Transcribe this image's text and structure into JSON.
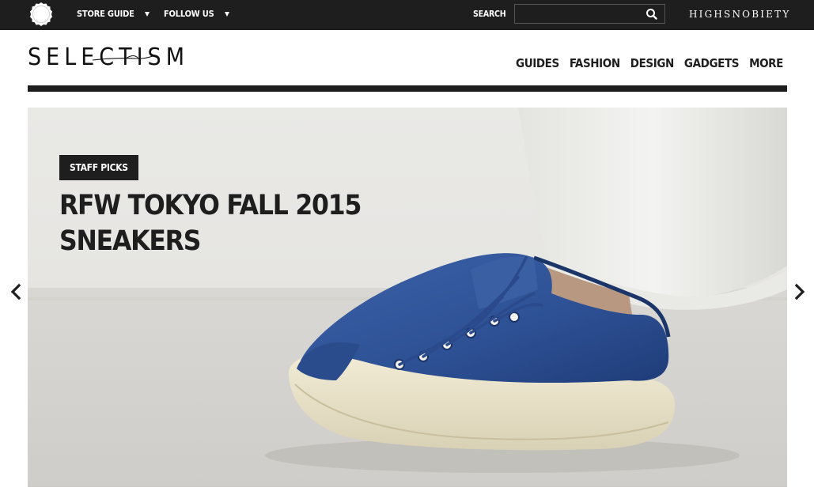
{
  "topbar": {
    "logo_icon": "selectism-seal-icon",
    "store_guide_label": "STORE GUIDE",
    "follow_us_label": "FOLLOW US",
    "search_label": "SEARCH",
    "search_value": "",
    "search_icon": "search-icon",
    "partner_logo": "HIGHSNOBIETY"
  },
  "header": {
    "brand": "SELECTISM",
    "nav": [
      "GUIDES",
      "FASHION",
      "DESIGN",
      "GADGETS",
      "MORE"
    ]
  },
  "hero": {
    "tag": "STAFF PICKS",
    "title": "RFW TOKYO FALL 2015 SNEAKERS",
    "image": "blue corduroy sneaker photo",
    "prev_icon": "chevron-left-icon",
    "next_icon": "chevron-right-icon"
  },
  "colors": {
    "dark": "#1e1e1e",
    "white": "#ffffff",
    "sneaker_blue": "#2f4f8f"
  }
}
